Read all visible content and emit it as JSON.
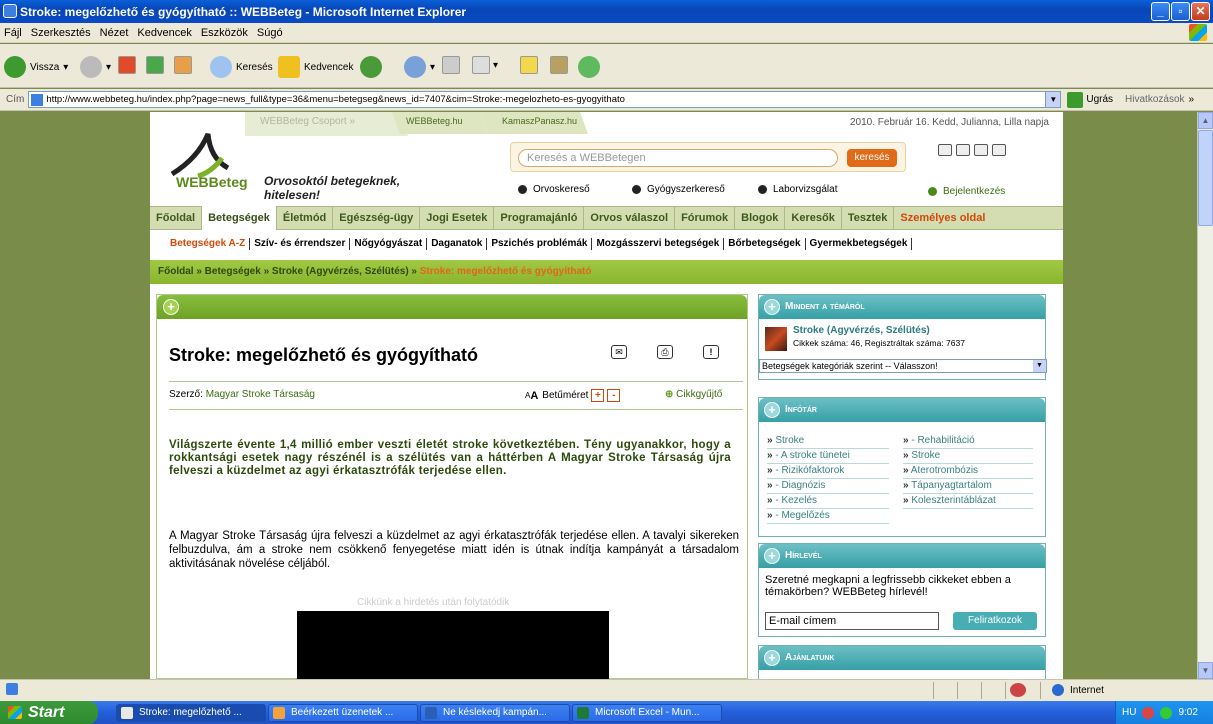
{
  "window": {
    "title": "Stroke: megelőzhető és gyógyítható :: WEBBeteg - Microsoft Internet Explorer"
  },
  "menu": [
    "Fájl",
    "Szerkesztés",
    "Nézet",
    "Kedvencek",
    "Eszközök",
    "Súgó"
  ],
  "toolbar": {
    "back": "Vissza",
    "search": "Keresés",
    "favorites": "Kedvencek"
  },
  "address": {
    "label": "Cím",
    "url": "http://www.webbeteg.hu/index.php?page=news_full&type=36&menu=betegseg&news_id=7407&cim=Stroke:-megelozheto-es-gyogyithato",
    "go": "Ugrás",
    "links": "Hivatkozások"
  },
  "site": {
    "tabs": [
      "WEBBeteg Csoport »",
      "WEBBeteg.hu",
      "KamaszPanasz.hu"
    ],
    "date": "2010. Február 16. Kedd, Julianna, Lilla napja",
    "logo_text": "WEBBeteg",
    "slogan": "Orvosoktól betegeknek, hitelesen!",
    "search_placeholder": "Keresés a WEBBetegen",
    "search_button": "keresés",
    "quick_links": [
      "Orvoskereső",
      "Gyógyszerkereső",
      "Laborvizsgálat"
    ],
    "login": "Bejelentkezés",
    "main_nav": [
      "Főoldal",
      "Betegségek",
      "Életmód",
      "Egészség-ügy",
      "Jogi Esetek",
      "Programajánló",
      "Orvos válaszol",
      "Fórumok",
      "Blogok",
      "Keresők",
      "Tesztek",
      "Személyes oldal"
    ],
    "sub_nav": [
      "Betegségek A-Z",
      "Szív- és érrendszer",
      "Nőgyógyászat",
      "Daganatok",
      "Pszichés problémák",
      "Mozgásszervi betegségek",
      "Bőrbetegségek",
      "Gyermekbetegségek"
    ],
    "breadcrumb": {
      "path": "Főoldal » Betegségek » Stroke (Agyvérzés, Szélütés) » ",
      "current": "Stroke: megelőzhető és gyógyítható"
    }
  },
  "article": {
    "title": "Stroke: megelőzhető és gyógyítható",
    "author_label": "Szerző:",
    "author": "Magyar Stroke Társaság",
    "font_size_label": "Betűméret",
    "collector": "Cikkgyűjtő",
    "lead": "Világszerte évente 1,4 millió ember veszti életét stroke következtében. Tény ugyanakkor, hogy a rokkantsági esetek nagy részénél is a szélütés van a háttérben A Magyar Stroke Társaság újra felveszi a küzdelmet az agyi érkatasztrófák terjedése ellen.",
    "body": "A Magyar Stroke Társaság újra felveszi a küzdelmet az agyi érkatasztrófák terjedése ellen. A tavalyi sikereken felbuzdulva, ám a stroke nem csökkenő fenyegetése miatt idén is útnak indítja kampányát a társadalom aktivitásának növelése céljából.",
    "ad_label": "Cikkünk a hirdetés után folytatódik"
  },
  "sidebar": {
    "about": {
      "title": "Mindent a témáról",
      "topic": "Stroke (Agyvérzés, Szélütés)",
      "stats": "Cikkek száma: 46, Regisztráltak száma: 7637",
      "select": "Betegségek kategóriák szerint -- Válasszon!"
    },
    "info": {
      "title": "Infótár",
      "left": [
        "Stroke",
        "- A stroke tünetei",
        "- Rizikófaktorok",
        "- Diagnózis",
        "- Kezelés",
        "- Megelőzés"
      ],
      "right": [
        "- Rehabilitáció",
        "Stroke",
        "Aterotrombózis",
        "Tápanyagtartalom",
        "Koleszterintáblázat"
      ]
    },
    "newsletter": {
      "title": "Hírlevél",
      "text": "Szeretné megkapni a legfrissebb cikkeket ebben a témakörben? WEBBeteg hírlevél!",
      "email": "E-mail címem",
      "button": "Feliratkozok"
    },
    "recommend": {
      "title": "Ajánlatunk"
    }
  },
  "status": {
    "zone": "Internet"
  },
  "taskbar": {
    "start": "Start",
    "tasks": [
      "Stroke: megelőzhető ...",
      "Beérkezett üzenetek ...",
      "Ne késlekedj kampán...",
      "Microsoft Excel - Mun..."
    ],
    "lang": "HU",
    "clock": "9:02"
  }
}
